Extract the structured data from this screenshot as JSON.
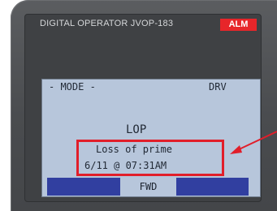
{
  "device": {
    "model_label": "DIGITAL OPERATOR JVOP-183",
    "alarm_badge": "ALM"
  },
  "display": {
    "mode_label": "- MODE -",
    "drive_label": "DRV",
    "status_code": "LOP",
    "fault_description": "Loss of prime",
    "fault_timestamp": "6/11 @ 07:31AM",
    "softkey_center_label": "FWD"
  },
  "colors": {
    "alarm_red": "#e7262a",
    "lcd_background": "#b7c6db",
    "softkey_blue": "#313fa0",
    "callout_red": "#e11e2a"
  },
  "icons": {
    "callout_arrow": "arrow-pointing-left"
  }
}
